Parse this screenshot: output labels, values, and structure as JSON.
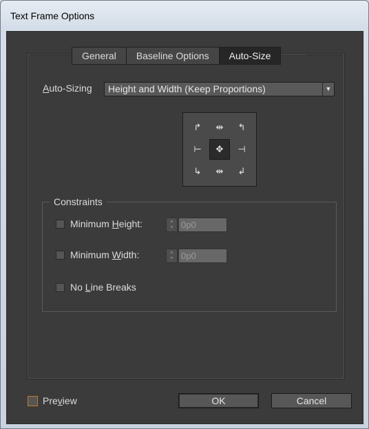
{
  "window": {
    "title": "Text Frame Options"
  },
  "tabs": [
    {
      "label": "General",
      "active": false
    },
    {
      "label": "Baseline Options",
      "active": false
    },
    {
      "label": "Auto-Size",
      "active": true
    }
  ],
  "auto_sizing": {
    "label_prefix": "A",
    "label_rest": "uto-Sizing",
    "selected": "Height and Width (Keep Proportions)"
  },
  "reference_grid": {
    "selected": "center",
    "points": [
      "top-left",
      "top-center",
      "top-right",
      "middle-left",
      "center",
      "middle-right",
      "bottom-left",
      "bottom-center",
      "bottom-right"
    ]
  },
  "constraints": {
    "legend": "Constraints",
    "min_height": {
      "label_a": "Minimum ",
      "label_u": "H",
      "label_b": "eight:",
      "checked": false,
      "value": "0p0"
    },
    "min_width": {
      "label_a": "Minimum ",
      "label_u": "W",
      "label_b": "idth:",
      "checked": false,
      "value": "0p0"
    },
    "no_line_breaks": {
      "label_a": "No ",
      "label_u": "L",
      "label_b": "ine Breaks",
      "checked": false
    }
  },
  "preview": {
    "label_a": "Pre",
    "label_u": "v",
    "label_b": "iew",
    "checked": false
  },
  "buttons": {
    "ok": "OK",
    "cancel": "Cancel"
  },
  "colors": {
    "accent": "#c07a2a",
    "panel_bg": "#3b3b3b"
  }
}
